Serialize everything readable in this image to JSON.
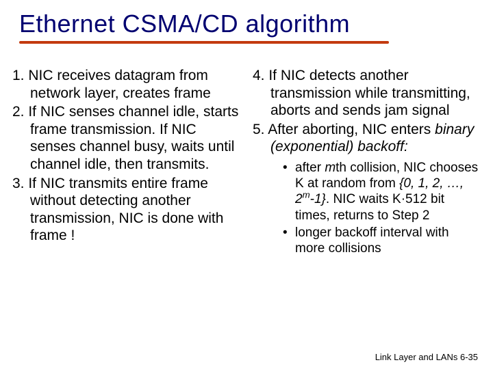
{
  "title": "Ethernet CSMA/CD algorithm",
  "left": {
    "p1a": "1. NIC receives datagram from network layer, creates frame",
    "p2a": "2. If NIC senses channel idle, starts frame transmission. If NIC senses channel busy, waits until channel idle, then transmits.",
    "p3a": "3. If NIC transmits entire frame without detecting another transmission, NIC is done with frame !"
  },
  "right": {
    "p4": "4. If NIC detects another transmission while transmitting,  aborts and sends jam signal",
    "p5_prefix": "5. After aborting, NIC enters ",
    "p5_em": "binary (exponential) backoff:",
    "b1_a": "after ",
    "b1_m": "m",
    "b1_b": "th collision, NIC chooses K at random from ",
    "b1_set_open": "{0, 1, 2, …, 2",
    "b1_set_sup": "m",
    "b1_set_close": "-1}",
    "b1_c": ". NIC waits K·512 bit times, returns to Step 2",
    "b2": "longer backoff interval with more collisions"
  },
  "footer": "Link Layer and LANs   6-35"
}
